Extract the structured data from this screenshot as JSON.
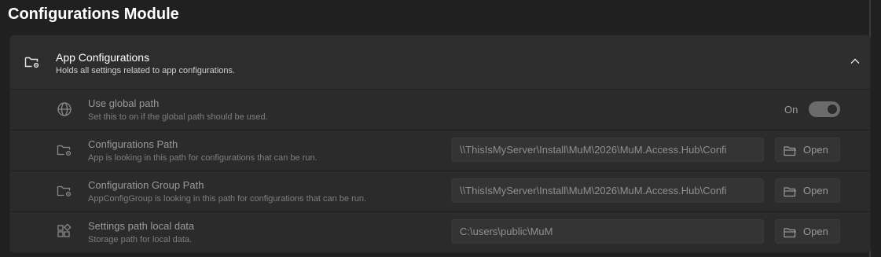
{
  "page": {
    "title": "Configurations Module"
  },
  "section": {
    "icon": "folder-settings-icon",
    "title": "App Configurations",
    "subtitle": "Holds all settings related to app configurations.",
    "expanded": true,
    "chevron_icon": "chevron-up-icon"
  },
  "settings": {
    "global_path": {
      "icon": "globe-icon",
      "title": "Use global path",
      "description": "Set this to on if the global path should be used.",
      "state_label": "On",
      "enabled": true
    },
    "configurations_path": {
      "icon": "folder-settings-icon",
      "title": "Configurations Path",
      "description": "App is looking in this path for configurations that can be run.",
      "value": "\\\\ThisIsMyServer\\Install\\MuM\\2026\\MuM.Access.Hub\\Confi",
      "button_label": "Open",
      "button_icon": "folder-open-icon"
    },
    "configuration_group_path": {
      "icon": "folder-settings-icon",
      "title": "Configuration Group Path",
      "description": "AppConfigGroup is looking in this path for configurations that can be run.",
      "value": "\\\\ThisIsMyServer\\Install\\MuM\\2026\\MuM.Access.Hub\\Confi",
      "button_label": "Open",
      "button_icon": "folder-open-icon"
    },
    "local_data": {
      "icon": "apps-add-icon",
      "title": "Settings path local data",
      "description": "Storage path for local data.",
      "value": "C:\\users\\public\\MuM",
      "button_label": "Open",
      "button_icon": "folder-open-icon"
    }
  },
  "colors": {
    "background": "#202020",
    "card": "#2b2b2b",
    "toggle_on": "#6b6b6b",
    "disabled_text": "#9a9a9a"
  }
}
